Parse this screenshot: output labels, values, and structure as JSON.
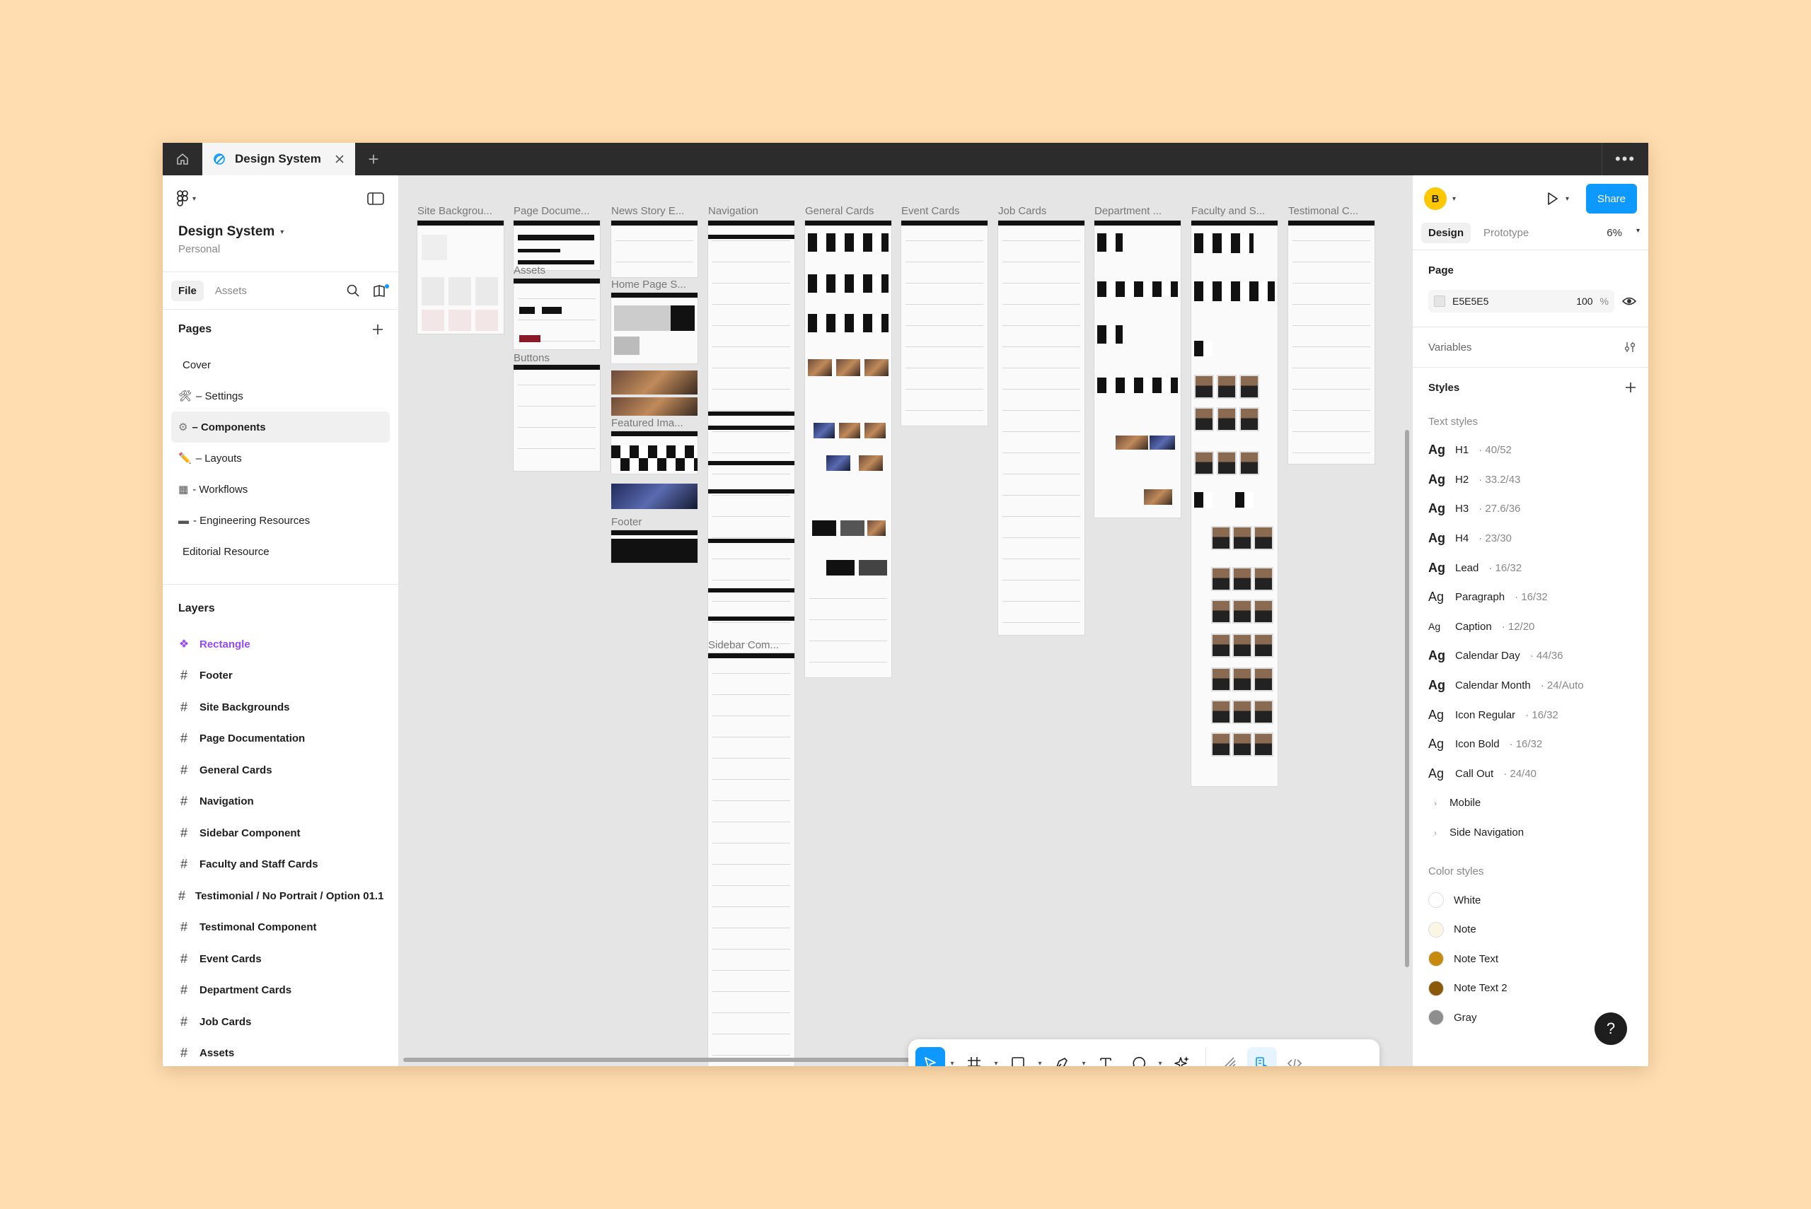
{
  "tabbar": {
    "home_icon": "home-icon",
    "active_tab": "Design System",
    "add_label": "+",
    "more_label": "•••"
  },
  "left": {
    "project_name": "Design System",
    "project_sub": "Personal",
    "tabs": [
      "File",
      "Assets"
    ],
    "pages_label": "Pages",
    "pages": [
      {
        "icon": "",
        "label": "Cover"
      },
      {
        "icon": "🛠",
        "label": "– Settings"
      },
      {
        "icon": "⚙",
        "label": "– Components"
      },
      {
        "icon": "✏️",
        "label": "– Layouts"
      },
      {
        "icon": "▦",
        "label": "- Workflows"
      },
      {
        "icon": "▬",
        "label": "- Engineering Resources"
      },
      {
        "icon": "",
        "label": "Editorial Resource"
      }
    ],
    "layers_label": "Layers",
    "layers": [
      "Rectangle",
      "Footer",
      "Site Backgrounds",
      "Page Documentation",
      "General Cards",
      "Navigation",
      "Sidebar Component",
      "Faculty and Staff Cards",
      "Testimonial / No Portrait / Option 01.1",
      "Testimonal Component",
      "Event Cards",
      "Department Cards",
      "Job Cards",
      "Assets"
    ]
  },
  "canvas": {
    "frame_labels": [
      "Site Backgrou...",
      "Page Docume...",
      "News Story E...",
      "Navigation",
      "General Cards",
      "Event Cards",
      "Job Cards",
      "Department ...",
      "Faculty and S...",
      "Testimonal C..."
    ],
    "sub_labels": {
      "assets": "Assets",
      "buttons": "Buttons",
      "home_page": "Home Page S...",
      "featured": "Featured Ima...",
      "footer": "Footer",
      "sidebar": "Sidebar Com..."
    }
  },
  "right": {
    "avatar_letter": "B",
    "share_label": "Share",
    "tabs": [
      "Design",
      "Prototype"
    ],
    "zoom": "6%",
    "page_label": "Page",
    "page_color": "E5E5E5",
    "page_opacity": "100",
    "percent_sign": "%",
    "variables_label": "Variables",
    "styles_label": "Styles",
    "text_styles_label": "Text styles",
    "text_styles": [
      {
        "name": "H1",
        "meta": "· 40/52",
        "bold": true
      },
      {
        "name": "H2",
        "meta": "· 33.2/43",
        "bold": true
      },
      {
        "name": "H3",
        "meta": "· 27.6/36",
        "bold": true
      },
      {
        "name": "H4",
        "meta": "· 23/30",
        "bold": true
      },
      {
        "name": "Lead",
        "meta": "· 16/32",
        "bold": true
      },
      {
        "name": "Paragraph",
        "meta": "· 16/32",
        "bold": false
      },
      {
        "name": "Caption",
        "meta": "· 12/20",
        "bold": false
      },
      {
        "name": "Calendar Day",
        "meta": "· 44/36",
        "bold": true
      },
      {
        "name": "Calendar Month",
        "meta": "· 24/Auto",
        "bold": true
      },
      {
        "name": "Icon Regular",
        "meta": "· 16/32",
        "bold": false
      },
      {
        "name": "Icon Bold",
        "meta": "· 16/32",
        "bold": false
      },
      {
        "name": "Call Out",
        "meta": "· 24/40",
        "bold": false
      }
    ],
    "text_groups": [
      "Mobile",
      "Side Navigation"
    ],
    "color_styles_label": "Color styles",
    "color_styles": [
      {
        "name": "White",
        "color": "#FFFFFF"
      },
      {
        "name": "Note",
        "color": "#FBF5E6"
      },
      {
        "name": "Note Text",
        "color": "#C58A0E"
      },
      {
        "name": "Note Text 2",
        "color": "#8A5A0A"
      },
      {
        "name": "Gray",
        "color": "#8E8E8E"
      }
    ],
    "help_label": "?"
  },
  "toolbar": {
    "tools": [
      "move-tool",
      "frame-tool",
      "shape-tool",
      "pen-tool",
      "text-tool",
      "comment-tool",
      "actions-tool",
      "draw-mode",
      "design-mode",
      "dev-mode"
    ]
  }
}
